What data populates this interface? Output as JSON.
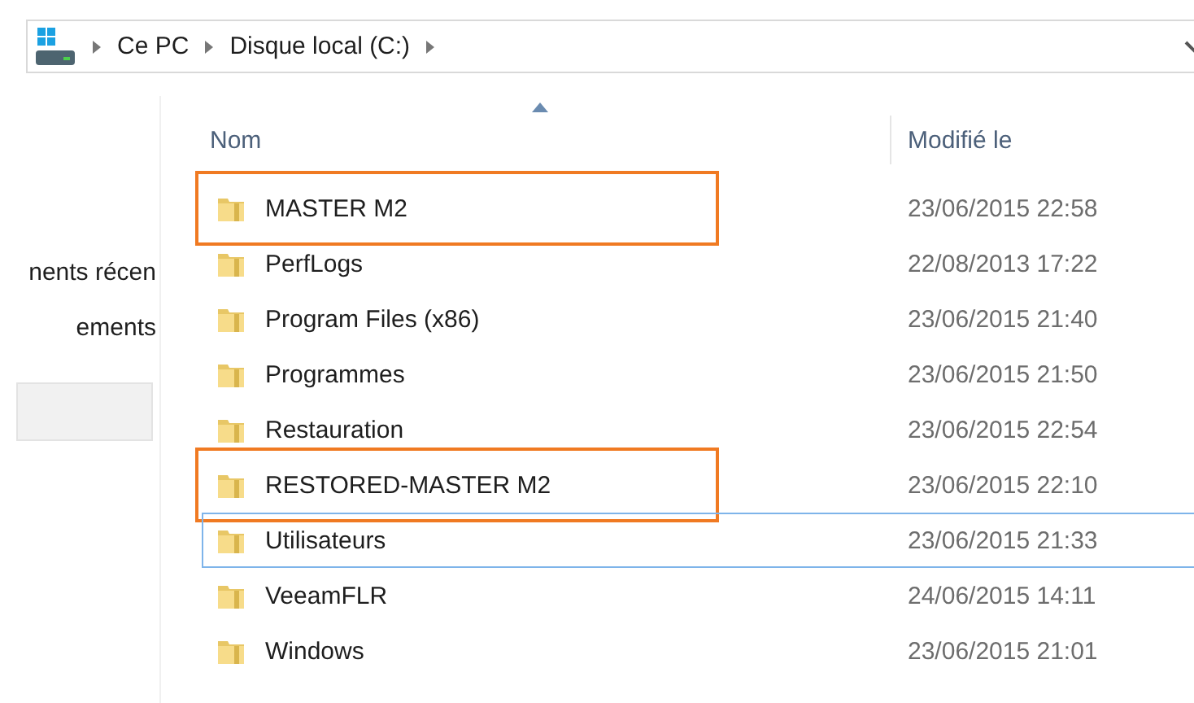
{
  "address_bar": {
    "segments": [
      "Ce PC",
      "Disque local (C:)"
    ]
  },
  "sidebar": {
    "items": [
      {
        "label": "nents récen"
      },
      {
        "label": "ements"
      }
    ]
  },
  "table": {
    "columns": [
      {
        "label": "Nom",
        "sorted": true
      },
      {
        "label": "Modifié le",
        "sorted": false
      }
    ],
    "rows": [
      {
        "name": "MASTER M2",
        "modified": "23/06/2015 22:58",
        "annotated": true,
        "focused": false
      },
      {
        "name": "PerfLogs",
        "modified": "22/08/2013 17:22",
        "annotated": false,
        "focused": false
      },
      {
        "name": "Program Files (x86)",
        "modified": "23/06/2015 21:40",
        "annotated": false,
        "focused": false
      },
      {
        "name": "Programmes",
        "modified": "23/06/2015 21:50",
        "annotated": false,
        "focused": false
      },
      {
        "name": "Restauration",
        "modified": "23/06/2015 22:54",
        "annotated": false,
        "focused": false
      },
      {
        "name": "RESTORED-MASTER M2",
        "modified": "23/06/2015 22:10",
        "annotated": true,
        "focused": false
      },
      {
        "name": "Utilisateurs",
        "modified": "23/06/2015 21:33",
        "annotated": false,
        "focused": true
      },
      {
        "name": "VeeamFLR",
        "modified": "24/06/2015 14:11",
        "annotated": false,
        "focused": false
      },
      {
        "name": "Windows",
        "modified": "23/06/2015 21:01",
        "annotated": false,
        "focused": false
      }
    ]
  }
}
